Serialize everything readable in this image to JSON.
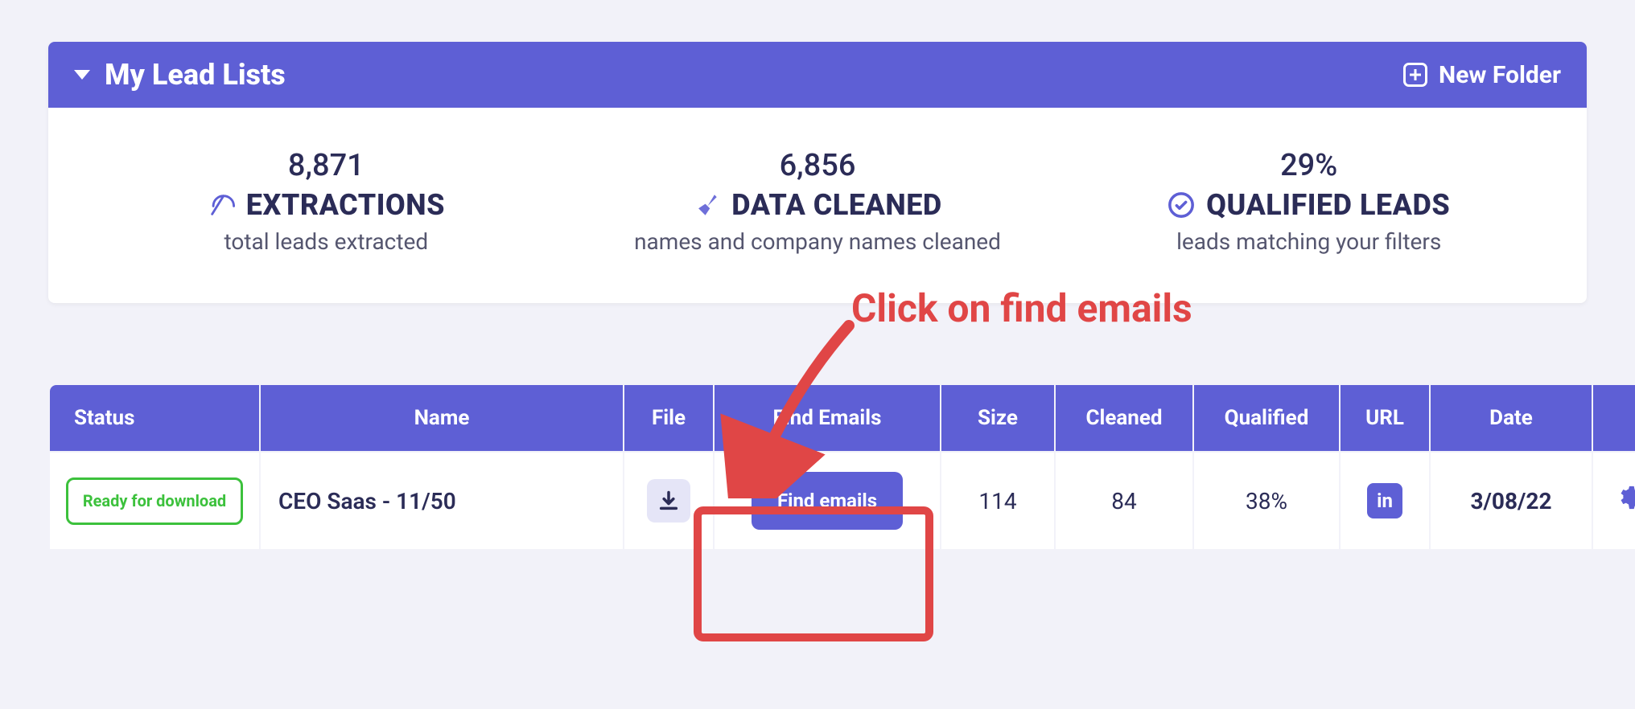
{
  "panel": {
    "title": "My Lead Lists",
    "new_folder_label": "New Folder"
  },
  "stats": {
    "extractions": {
      "value": "8,871",
      "label": "EXTRACTIONS",
      "sub": "total leads extracted"
    },
    "cleaned": {
      "value": "6,856",
      "label": "DATA CLEANED",
      "sub": "names and company names cleaned"
    },
    "qualified": {
      "value": "29%",
      "label": "QUALIFIED LEADS",
      "sub": "leads matching your filters"
    }
  },
  "annotation": {
    "text": "Click on find emails"
  },
  "table": {
    "headers": {
      "status": "Status",
      "name": "Name",
      "file": "File",
      "find_emails": "Find Emails",
      "size": "Size",
      "cleaned": "Cleaned",
      "qualified": "Qualified",
      "url": "URL",
      "date": "Date",
      "actions": ""
    },
    "rows": [
      {
        "status": "Ready for download",
        "name": "CEO Saas - 11/50",
        "find_emails_label": "Find emails",
        "size": "114",
        "cleaned": "84",
        "qualified": "38%",
        "url_kind": "linkedin",
        "linkedin_label": "in",
        "date": "3/08/22"
      }
    ]
  }
}
